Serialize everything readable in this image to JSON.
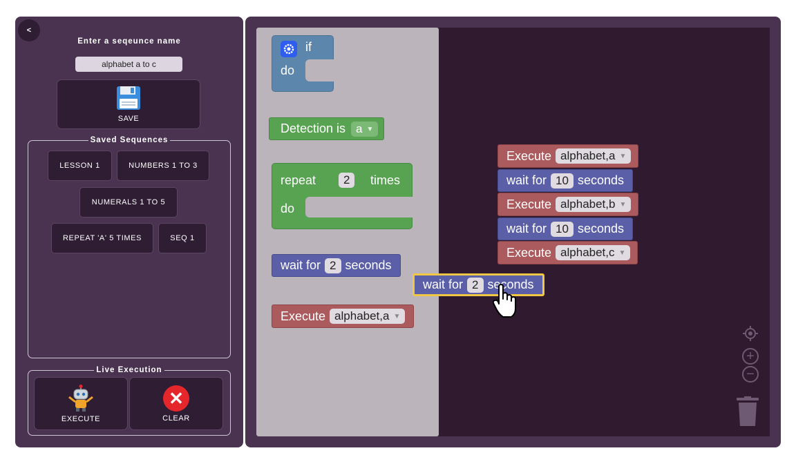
{
  "left": {
    "back_label": "<",
    "title": "Enter a seqeunce name",
    "name_value": "alphabet a to c",
    "save_label": "SAVE",
    "saved_legend": "Saved Sequences",
    "sequences": [
      "LESSON 1",
      "NUMBERS 1 TO 3",
      "NUMERALS 1 TO 5",
      "REPEAT 'A' 5 TIMES",
      "SEQ 1"
    ],
    "live_legend": "Live Execution",
    "execute_label": "EXECUTE",
    "clear_label": "CLEAR",
    "clear_symbol": "✕"
  },
  "flyout": {
    "if_label": "if",
    "do_label": "do",
    "detection_label": "Detection is",
    "detection_value": "a",
    "repeat_label": "repeat",
    "repeat_count": "2",
    "times_label": "times",
    "repeat_do_label": "do",
    "wait_label": "wait for",
    "wait_value": "2",
    "seconds_label": "seconds",
    "execute_label": "Execute",
    "execute_value": "alphabet,a"
  },
  "workspace": {
    "stack": [
      {
        "type": "execute",
        "label": "Execute",
        "value": "alphabet,a"
      },
      {
        "type": "wait",
        "label": "wait for",
        "value": "10",
        "unit": "seconds"
      },
      {
        "type": "execute",
        "label": "Execute",
        "value": "alphabet,b"
      },
      {
        "type": "wait",
        "label": "wait for",
        "value": "10",
        "unit": "seconds"
      },
      {
        "type": "execute",
        "label": "Execute",
        "value": "alphabet,c"
      }
    ],
    "dragged": {
      "label": "wait for",
      "value": "2",
      "unit": "seconds"
    }
  },
  "controls": {
    "zoom_in": "+",
    "zoom_out": "−"
  },
  "colors": {
    "panel": "#4a3350",
    "workspace": "#301a30",
    "flyout": "#bbb4bb",
    "execute_block": "#ab5a5d",
    "wait_block": "#5a5fa7",
    "logic_block": "#5c86ab",
    "green_block": "#58a352",
    "drag_highlight": "#f2c744"
  },
  "icons": [
    "save-icon",
    "robot-icon",
    "clear-icon",
    "gear-icon",
    "recenter-icon",
    "zoom-in-icon",
    "zoom-out-icon",
    "trash-icon",
    "hand-cursor-icon"
  ]
}
